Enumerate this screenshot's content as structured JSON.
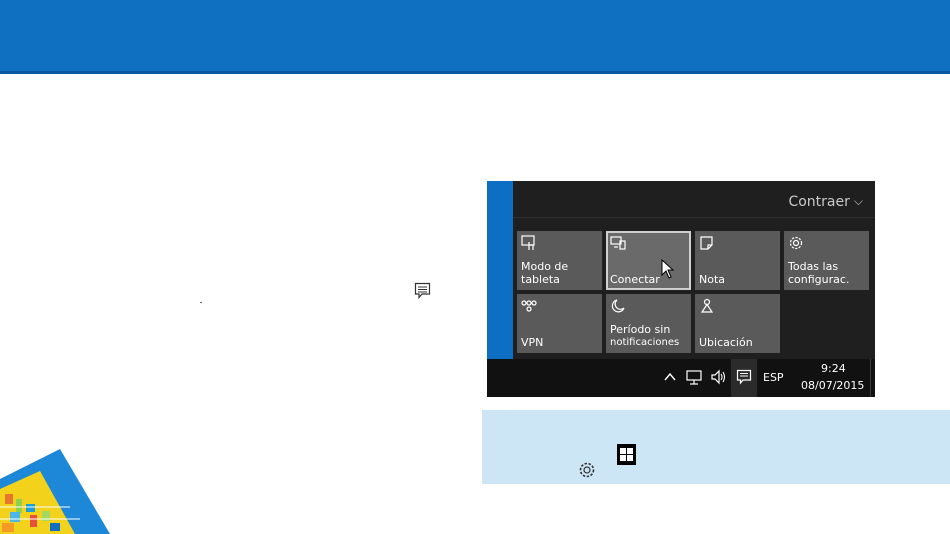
{
  "action_center": {
    "collapse_label": "Contraer",
    "tiles": [
      {
        "label": "Modo de tableta",
        "line1": "Modo de",
        "line2": "tableta",
        "icon": "tablet-mode-icon"
      },
      {
        "label": "Conectar",
        "icon": "connect-icon",
        "selected": true
      },
      {
        "label": "Nota",
        "icon": "note-icon"
      },
      {
        "label": "Todas las configurac.",
        "line1": "Todas las",
        "line2": "configurac.",
        "icon": "settings-gear-icon"
      },
      {
        "label": "VPN",
        "icon": "vpn-icon"
      },
      {
        "label": "Período sin notificaciones",
        "line1": "Período sin",
        "line2": "notificaciones",
        "icon": "moon-icon"
      },
      {
        "label": "Ubicación",
        "icon": "location-icon"
      }
    ]
  },
  "taskbar": {
    "language": "ESP",
    "time": "9:24",
    "date": "08/07/2015",
    "icons": [
      "chevron-up-icon",
      "network-icon",
      "volume-icon",
      "action-center-icon"
    ]
  },
  "colors": {
    "header_blue": "#0f6fc0",
    "tip_background": "#cde6f5",
    "tile_gray": "#5a5a5a",
    "panel_dark": "#1f1f1f"
  }
}
